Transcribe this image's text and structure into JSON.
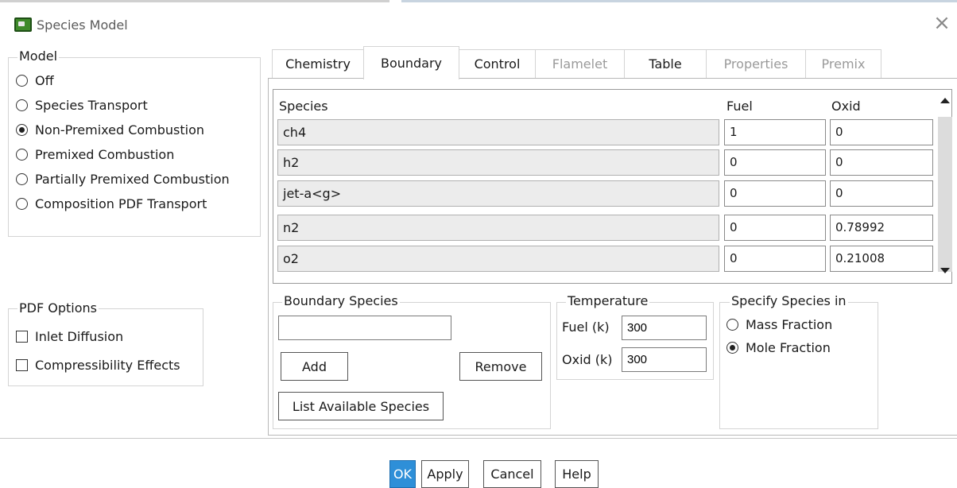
{
  "window": {
    "title": "Species Model",
    "close_glyph": "×"
  },
  "model": {
    "legend": "Model",
    "options": [
      {
        "label": "Off",
        "selected": false
      },
      {
        "label": "Species Transport",
        "selected": false
      },
      {
        "label": "Non-Premixed Combustion",
        "selected": true
      },
      {
        "label": "Premixed Combustion",
        "selected": false
      },
      {
        "label": "Partially Premixed Combustion",
        "selected": false
      },
      {
        "label": "Composition PDF Transport",
        "selected": false
      }
    ]
  },
  "pdf_options": {
    "legend": "PDF Options",
    "inlet_diffusion": {
      "label": "Inlet Diffusion",
      "checked": false
    },
    "compressibility": {
      "label": "Compressibility Effects",
      "checked": false
    }
  },
  "tabs": [
    {
      "label": "Chemistry",
      "active": false,
      "enabled": true
    },
    {
      "label": "Boundary",
      "active": true,
      "enabled": true
    },
    {
      "label": "Control",
      "active": false,
      "enabled": true
    },
    {
      "label": "Flamelet",
      "active": false,
      "enabled": false
    },
    {
      "label": "Table",
      "active": false,
      "enabled": true
    },
    {
      "label": "Properties",
      "active": false,
      "enabled": false
    },
    {
      "label": "Premix",
      "active": false,
      "enabled": false
    }
  ],
  "boundary_table": {
    "headers": {
      "species": "Species",
      "fuel": "Fuel",
      "oxid": "Oxid"
    },
    "rows": [
      {
        "species": "ch4",
        "fuel": "1",
        "oxid": "0"
      },
      {
        "species": "h2",
        "fuel": "0",
        "oxid": "0"
      },
      {
        "species": "jet-a<g>",
        "fuel": "0",
        "oxid": "0"
      },
      {
        "species": "n2",
        "fuel": "0",
        "oxid": "0.78992"
      },
      {
        "species": "o2",
        "fuel": "0",
        "oxid": "0.21008"
      }
    ]
  },
  "boundary_species": {
    "legend": "Boundary Species",
    "input_value": "",
    "add_label": "Add",
    "remove_label": "Remove",
    "list_label": "List Available Species"
  },
  "temperature": {
    "legend": "Temperature",
    "fuel_label": "Fuel (k)",
    "fuel_value": "300",
    "oxid_label": "Oxid (k)",
    "oxid_value": "300"
  },
  "specify_species": {
    "legend": "Specify Species in",
    "mass_fraction": {
      "label": "Mass Fraction",
      "selected": false
    },
    "mole_fraction": {
      "label": "Mole Fraction",
      "selected": true
    }
  },
  "footer": {
    "ok": "OK",
    "apply": "Apply",
    "cancel": "Cancel",
    "help": "Help"
  },
  "colors": {
    "primary_button": "#2e8fd8",
    "disabled_text": "#9a9a9a",
    "name_cell_bg": "#ececec"
  }
}
